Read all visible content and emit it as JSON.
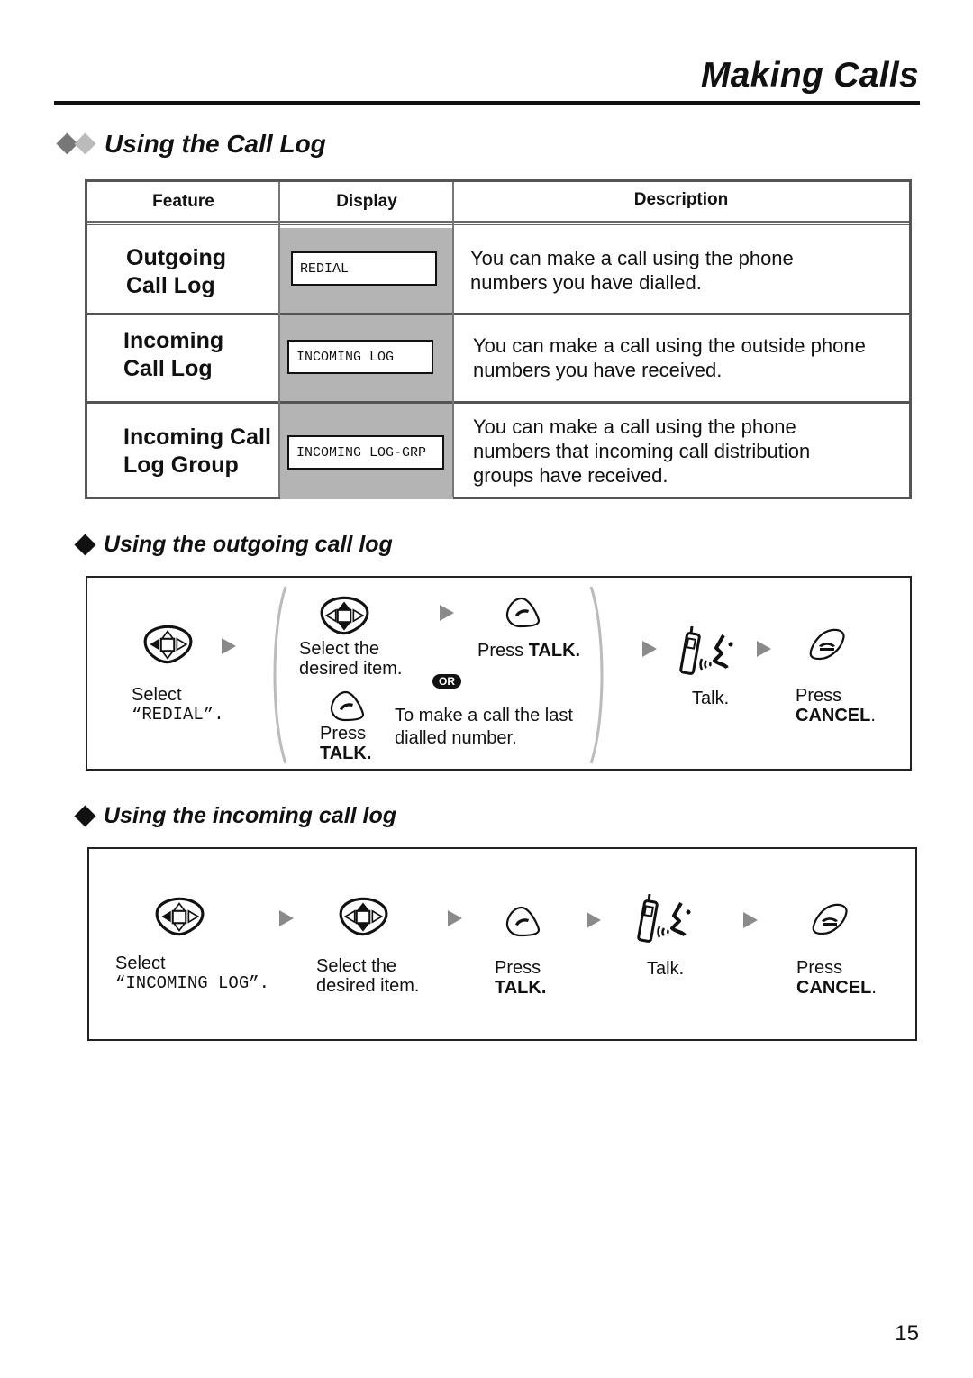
{
  "header": {
    "title": "Making Calls"
  },
  "section": {
    "title": "Using the Call Log"
  },
  "table": {
    "headers": {
      "feature": "Feature",
      "display": "Display",
      "description": "Description"
    },
    "rows": [
      {
        "feature_line1": "Outgoing",
        "feature_line2": "Call Log",
        "display": "REDIAL",
        "desc_line1": "You can make a call using the phone",
        "desc_line2": "numbers you have dialled.",
        "desc_line3": ""
      },
      {
        "feature_line1": "Incoming",
        "feature_line2": "Call Log",
        "display": "INCOMING LOG",
        "desc_line1": "You can make a call using the outside phone",
        "desc_line2": "numbers you have received.",
        "desc_line3": ""
      },
      {
        "feature_line1": "Incoming Call",
        "feature_line2": "Log Group",
        "display": "INCOMING LOG-GRP",
        "desc_line1": "You can make a call using the phone",
        "desc_line2": "numbers that incoming call distribution",
        "desc_line3": "groups have received."
      }
    ]
  },
  "outgoing": {
    "title": "Using the outgoing call log",
    "step1": {
      "line1": "Select",
      "line2": "“REDIAL”."
    },
    "alt_a": {
      "line1": "Select the",
      "line2": "desired item.",
      "press": "Press ",
      "key": "TALK."
    },
    "or_label": "OR",
    "alt_b": {
      "press": "Press",
      "key": "TALK.",
      "line1": "To make a call the last",
      "line2": "dialled number."
    },
    "talk": "Talk.",
    "cancel": {
      "press": "Press",
      "key": "CANCEL",
      "dot": "."
    }
  },
  "incoming": {
    "title": "Using the incoming call log",
    "step1": {
      "line1": "Select",
      "line2": "“INCOMING LOG”."
    },
    "step2": {
      "line1": "Select the",
      "line2": "desired item."
    },
    "step3": {
      "press": "Press",
      "key": "TALK."
    },
    "talk": "Talk.",
    "cancel": {
      "press": "Press",
      "key": "CANCEL",
      "dot": "."
    }
  },
  "icons": {
    "nav_key": "navigator-key-icon",
    "talk_key": "talk-key-icon",
    "cancel_key": "cancel-key-icon",
    "talking": "handset-talking-icon",
    "step_arrow": "step-arrow-icon"
  },
  "page_number": "15"
}
